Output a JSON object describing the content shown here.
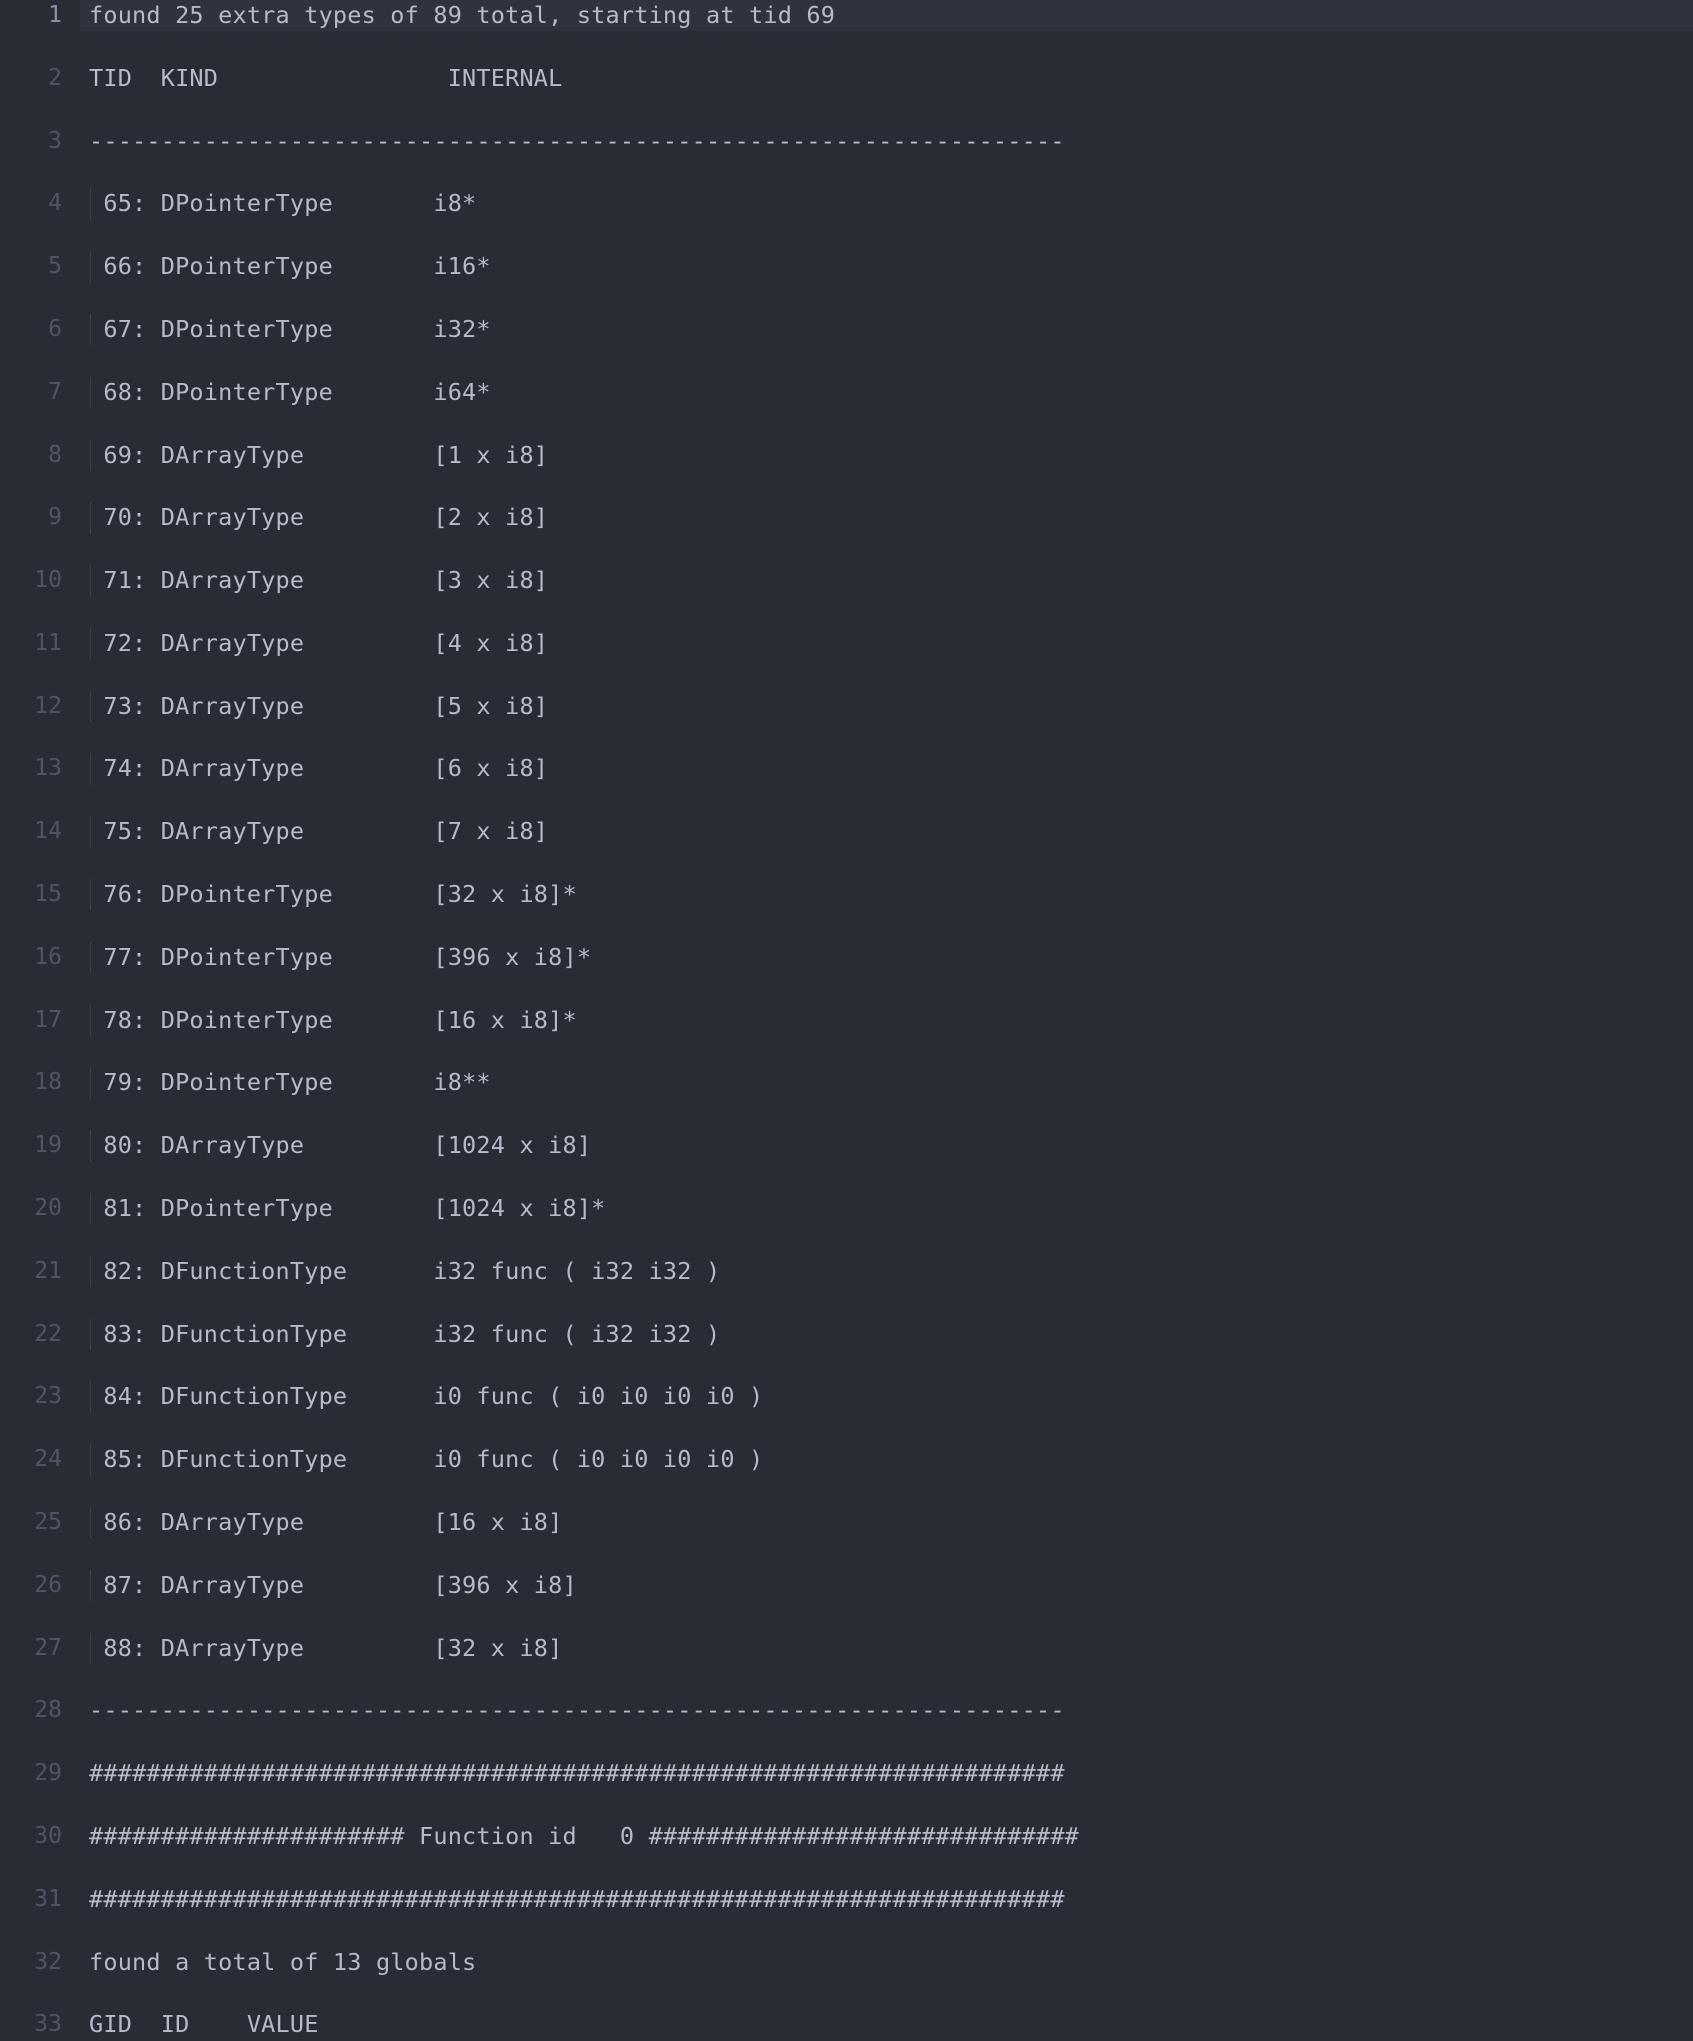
{
  "theme": {
    "background": "#282c34",
    "current_line_background": "#2f333d",
    "text_color": "#b4bcc9",
    "gutter_color": "#4e5666",
    "gutter_active_color": "#8b94a6",
    "indent_guide_color": "#3b4049"
  },
  "editor": {
    "first_line_number": 1,
    "last_line_number": 33,
    "active_line_number": 1,
    "separator_dashes": "--------------------------------------------------------------------",
    "hash_rule": "####################################################################",
    "lines": [
      {
        "n": 1,
        "text": "found 25 extra types of 89 total, starting at tid 69",
        "active": true,
        "guide": false
      },
      {
        "n": 2,
        "text": "TID  KIND                INTERNAL",
        "active": false,
        "guide": false
      },
      {
        "n": 3,
        "text": "--------------------------------------------------------------------",
        "active": false,
        "guide": false
      },
      {
        "n": 4,
        "text": " 65: DPointerType       i8*",
        "active": false,
        "guide": true
      },
      {
        "n": 5,
        "text": " 66: DPointerType       i16*",
        "active": false,
        "guide": true
      },
      {
        "n": 6,
        "text": " 67: DPointerType       i32*",
        "active": false,
        "guide": true
      },
      {
        "n": 7,
        "text": " 68: DPointerType       i64*",
        "active": false,
        "guide": true
      },
      {
        "n": 8,
        "text": " 69: DArrayType         [1 x i8]",
        "active": false,
        "guide": true
      },
      {
        "n": 9,
        "text": " 70: DArrayType         [2 x i8]",
        "active": false,
        "guide": true
      },
      {
        "n": 10,
        "text": " 71: DArrayType         [3 x i8]",
        "active": false,
        "guide": true
      },
      {
        "n": 11,
        "text": " 72: DArrayType         [4 x i8]",
        "active": false,
        "guide": true
      },
      {
        "n": 12,
        "text": " 73: DArrayType         [5 x i8]",
        "active": false,
        "guide": true
      },
      {
        "n": 13,
        "text": " 74: DArrayType         [6 x i8]",
        "active": false,
        "guide": true
      },
      {
        "n": 14,
        "text": " 75: DArrayType         [7 x i8]",
        "active": false,
        "guide": true
      },
      {
        "n": 15,
        "text": " 76: DPointerType       [32 x i8]*",
        "active": false,
        "guide": true
      },
      {
        "n": 16,
        "text": " 77: DPointerType       [396 x i8]*",
        "active": false,
        "guide": true
      },
      {
        "n": 17,
        "text": " 78: DPointerType       [16 x i8]*",
        "active": false,
        "guide": true
      },
      {
        "n": 18,
        "text": " 79: DPointerType       i8**",
        "active": false,
        "guide": true
      },
      {
        "n": 19,
        "text": " 80: DArrayType         [1024 x i8]",
        "active": false,
        "guide": true
      },
      {
        "n": 20,
        "text": " 81: DPointerType       [1024 x i8]*",
        "active": false,
        "guide": true
      },
      {
        "n": 21,
        "text": " 82: DFunctionType      i32 func ( i32 i32 )",
        "active": false,
        "guide": true
      },
      {
        "n": 22,
        "text": " 83: DFunctionType      i32 func ( i32 i32 )",
        "active": false,
        "guide": true
      },
      {
        "n": 23,
        "text": " 84: DFunctionType      i0 func ( i0 i0 i0 i0 )",
        "active": false,
        "guide": true
      },
      {
        "n": 24,
        "text": " 85: DFunctionType      i0 func ( i0 i0 i0 i0 )",
        "active": false,
        "guide": true
      },
      {
        "n": 25,
        "text": " 86: DArrayType         [16 x i8]",
        "active": false,
        "guide": true
      },
      {
        "n": 26,
        "text": " 87: DArrayType         [396 x i8]",
        "active": false,
        "guide": true
      },
      {
        "n": 27,
        "text": " 88: DArrayType         [32 x i8]",
        "active": false,
        "guide": true
      },
      {
        "n": 28,
        "text": "--------------------------------------------------------------------",
        "active": false,
        "guide": false
      },
      {
        "n": 29,
        "text": "####################################################################",
        "active": false,
        "guide": false
      },
      {
        "n": 30,
        "text": "###################### Function id   0 ##############################",
        "active": false,
        "guide": false
      },
      {
        "n": 31,
        "text": "####################################################################",
        "active": false,
        "guide": false
      },
      {
        "n": 32,
        "text": "found a total of 13 globals",
        "active": false,
        "guide": false
      },
      {
        "n": 33,
        "text": "GID  ID    VALUE",
        "active": false,
        "guide": false
      }
    ]
  }
}
